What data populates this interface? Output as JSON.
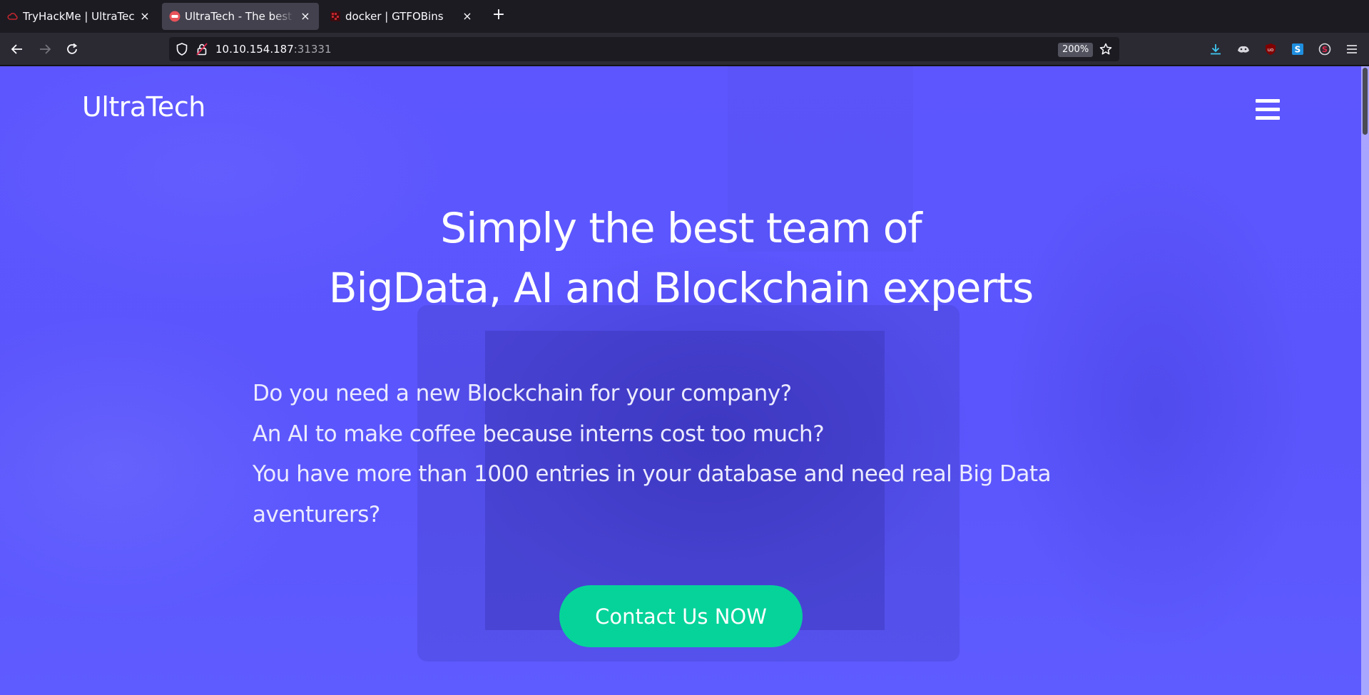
{
  "browser": {
    "tabs": [
      {
        "title": "TryHackMe | UltraTech",
        "favicon": "tryhackme-cloud-icon",
        "active": false
      },
      {
        "title": "UltraTech - The best of tech",
        "favicon": "ultratech-logo-icon",
        "active": true
      },
      {
        "title": "docker | GTFOBins",
        "favicon": "gtfobins-icon",
        "active": false
      }
    ],
    "close_glyph": "×",
    "new_tab_glyph": "+",
    "url_host": "10.10.154.187",
    "url_port": ":31331",
    "zoom": "200%",
    "colors": {
      "tabstrip": "#1c1b22",
      "navbar": "#2b2a33",
      "urlbar": "#1c1b22",
      "active_tab": "#42414d"
    }
  },
  "page": {
    "brand": "UltraTech",
    "menu_icon": "hamburger-menu-icon",
    "headline": [
      "Simply the best team of",
      "BigData, AI and Blockchain experts"
    ],
    "pitch": [
      "Do you need a new Blockchain for your company?",
      "An AI to make coffee because interns cost too much?",
      "You have more than 1000 entries in your database and need real Big Data",
      "aventurers?"
    ],
    "cta_label": "Contact Us NOW",
    "colors": {
      "hero_background": "#5b55ff",
      "cta_background": "#06d39a",
      "text": "#ffffff"
    }
  }
}
